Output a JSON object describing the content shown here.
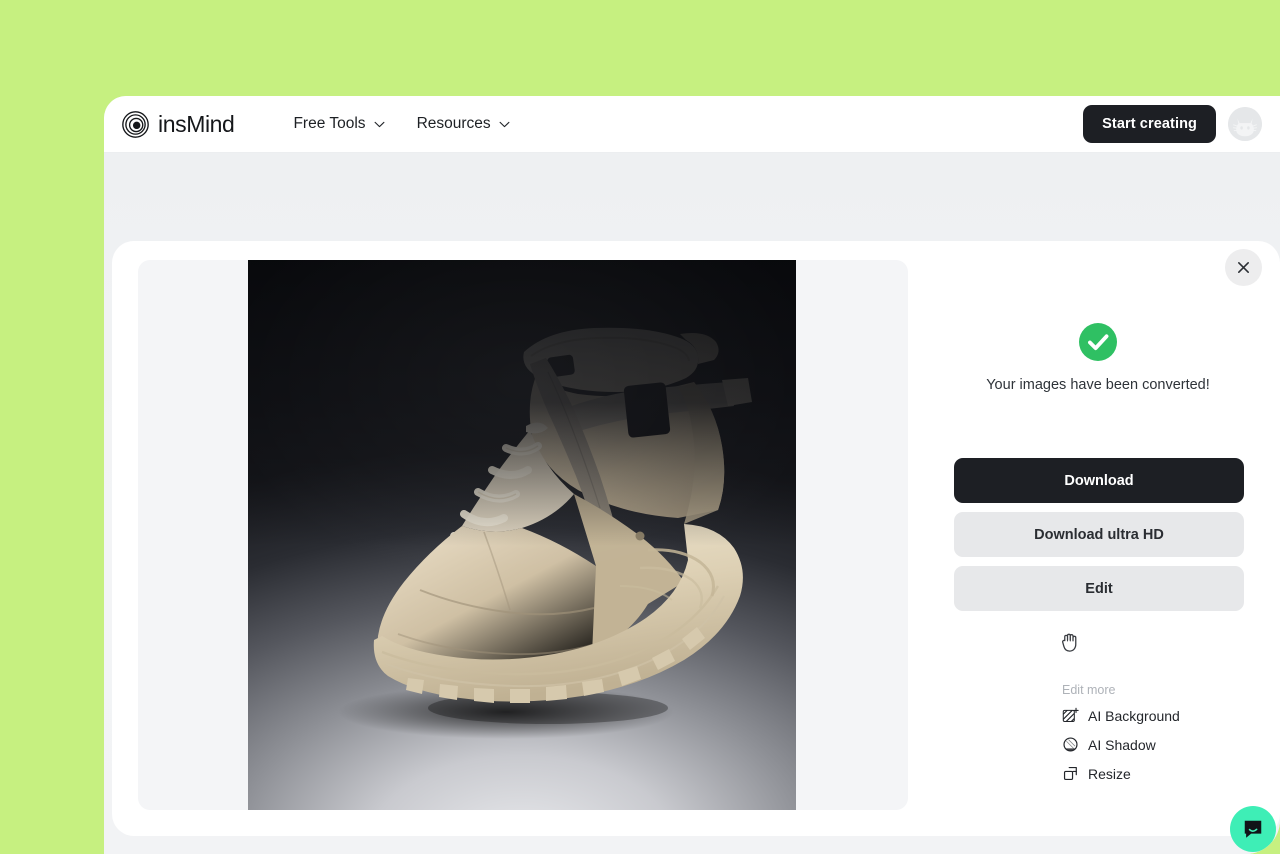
{
  "theme": {
    "canvas_bg": "#c6f080",
    "page_bg": "#f2f3f5",
    "nav_bg": "#ffffff",
    "modal_bg": "#ffffff",
    "primary_button_bg": "#1d1f24",
    "secondary_button_bg": "#e7e8ea",
    "success_green": "#2fc063",
    "chat_mint": "#3eeeb6",
    "preview_bg": "#f4f5f7"
  },
  "nav": {
    "brand": {
      "name": "insMind",
      "logo_icon": "concentric-circles-icon"
    },
    "links": [
      {
        "label": "Free Tools",
        "icon": "chevron-down-icon"
      },
      {
        "label": "Resources",
        "icon": "chevron-down-icon"
      }
    ],
    "cta_label": "Start creating",
    "avatar_icon": "cat-avatar-icon"
  },
  "modal": {
    "close_icon": "close-icon",
    "preview": {
      "image_alt": "beige high-top sneaker boot on dark studio backdrop",
      "cursor": "grab"
    },
    "panel": {
      "success_icon": "check-circle-icon",
      "status_text": "Your images have been converted!",
      "buttons": [
        {
          "name": "download-button",
          "label": "Download",
          "variant": "primary"
        },
        {
          "name": "download-ultra-hd-button",
          "label": "Download ultra HD",
          "variant": "secondary"
        },
        {
          "name": "edit-button",
          "label": "Edit",
          "variant": "secondary"
        }
      ],
      "grab_icon": "hand-grab-icon",
      "edit_more": {
        "label": "Edit more",
        "items": [
          {
            "label": "AI Background",
            "icon": "hatch-plus-icon"
          },
          {
            "label": "AI Shadow",
            "icon": "shaded-circle-icon"
          },
          {
            "label": "Resize",
            "icon": "overlapping-rects-icon"
          }
        ]
      }
    }
  },
  "chat": {
    "icon": "chat-bubble-icon",
    "label": "Open chat"
  }
}
